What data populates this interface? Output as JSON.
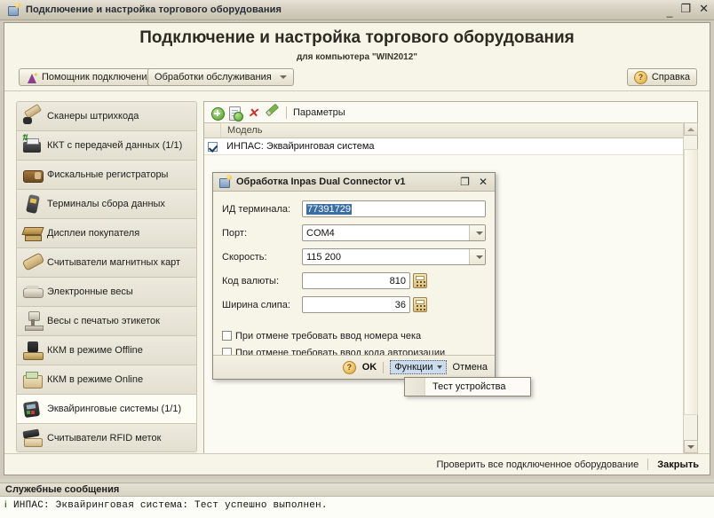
{
  "window": {
    "title": "Подключение и настройка торгового оборудования",
    "minimize": "_",
    "maximize": "❐",
    "close": "✕"
  },
  "header": {
    "title": "Подключение и настройка торгового оборудования",
    "subtitle": "для компьютера \"WIN2012\""
  },
  "commandbar": {
    "assistant": "Помощник подключения",
    "processing": "Обработки обслуживания",
    "help": "Справка"
  },
  "sidebar": {
    "items": [
      {
        "label": "Сканеры штрихкода",
        "icon": "barcode-scanner-icon",
        "selected": false
      },
      {
        "label": "ККТ с передачей данных (1/1)",
        "icon": "fiscal-printer-icon",
        "selected": false
      },
      {
        "label": "Фискальные регистраторы",
        "icon": "fiscal-register-icon",
        "selected": false
      },
      {
        "label": "Терминалы сбора данных",
        "icon": "data-terminal-icon",
        "selected": false
      },
      {
        "label": "Дисплеи покупателя",
        "icon": "customer-display-icon",
        "selected": false
      },
      {
        "label": "Считыватели магнитных карт",
        "icon": "magnetic-card-reader-icon",
        "selected": false
      },
      {
        "label": "Электронные весы",
        "icon": "electronic-scales-icon",
        "selected": false
      },
      {
        "label": "Весы с печатью этикеток",
        "icon": "label-printing-scales-icon",
        "selected": false
      },
      {
        "label": "ККМ в режиме Offline",
        "icon": "kkm-offline-icon",
        "selected": false
      },
      {
        "label": "ККМ в режиме Online",
        "icon": "kkm-online-icon",
        "selected": false
      },
      {
        "label": "Эквайринговые системы (1/1)",
        "icon": "acquiring-terminal-icon",
        "selected": true
      },
      {
        "label": "Считыватели RFID меток",
        "icon": "rfid-reader-icon",
        "selected": false
      }
    ]
  },
  "grid": {
    "toolbar": {
      "add": "add-icon",
      "copy": "copy-icon",
      "delete": "delete-icon",
      "edit": "edit-icon",
      "parameters": "Параметры"
    },
    "columns": [
      "Модель"
    ],
    "rows": [
      {
        "checked": true,
        "model": "ИНПАС: Эквайринговая система"
      }
    ]
  },
  "footer": {
    "check_all": "Проверить все подключенное оборудование",
    "close": "Закрыть"
  },
  "messages": {
    "header": "Служебные сообщения",
    "items": [
      {
        "icon": "i",
        "text": "ИНПАС: Эквайринговая система: Тест успешно выполнен."
      }
    ]
  },
  "dialog": {
    "title": "Обработка  Inpas Dual Connector v1",
    "maximize": "❐",
    "close": "✕",
    "fields": [
      {
        "label": "ИД терминала:",
        "value": "77391729",
        "type": "text",
        "selected": true
      },
      {
        "label": "Порт:",
        "value": "COM4",
        "type": "combo"
      },
      {
        "label": "Скорость:",
        "value": "115 200",
        "type": "combo"
      },
      {
        "label": "Код валюты:",
        "value": "810",
        "type": "number"
      },
      {
        "label": "Ширина слипа:",
        "value": "36",
        "type": "number"
      }
    ],
    "checkboxes": [
      {
        "label": "При отмене требовать ввод номера чека",
        "checked": false
      },
      {
        "label": "При отмене требовать ввод кода авторизации",
        "checked": false
      }
    ],
    "buttons": {
      "help": "?",
      "ok": "OK",
      "functions": "Функции",
      "cancel": "Отмена"
    }
  },
  "dropdown": {
    "items": [
      {
        "label": "Тест устройства"
      }
    ]
  },
  "colors": {
    "window_bg": "#d6d2c4",
    "client_bg": "#f7f4e8",
    "selection_blue": "#3a6ea5",
    "focus_blue": "#ccdcef",
    "accent_green": "#4e9a2f",
    "accent_red": "#cf2b2b"
  }
}
